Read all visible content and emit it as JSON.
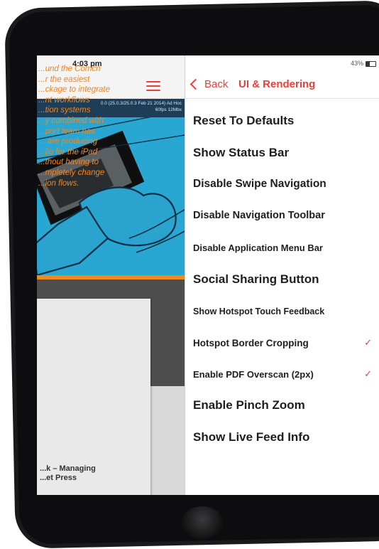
{
  "status": {
    "time": "4:03 pm",
    "battery": "43%"
  },
  "header": {
    "back_label": "Back",
    "title": "UI & Rendering"
  },
  "magazine": {
    "info_line1": "0.0 (25.0.3/25.0.3 Feb 21 2014) Ad Hoc",
    "info_line2": "60fps 12Mbx",
    "quote": "...und the Comcn\n...r the easiest\n...ckage to integrate\n...nt workflows\n...tion systems\n...y combined with\n...port team has\n... are producing\n...lio for the iPad\n...thout having to\n...mpletely change\n...ion flows.",
    "attribution": "...k – Managing\n...et Press"
  },
  "menu": {
    "items": [
      {
        "label": "Reset To Defaults",
        "checked": false
      },
      {
        "label": "Show Status Bar",
        "checked": false
      },
      {
        "label": "Disable Swipe Navigation",
        "checked": false
      },
      {
        "label": "Disable Navigation Toolbar",
        "checked": false
      },
      {
        "label": "Disable Application Menu Bar",
        "checked": false
      },
      {
        "label": "Social Sharing Button",
        "checked": false
      },
      {
        "label": "Show Hotspot Touch Feedback",
        "checked": false
      },
      {
        "label": "Hotspot Border Cropping",
        "checked": true
      },
      {
        "label": "Enable PDF Overscan (2px)",
        "checked": true
      },
      {
        "label": "Enable Pinch Zoom",
        "checked": false
      },
      {
        "label": "Show Live Feed Info",
        "checked": false
      }
    ]
  },
  "icons": {
    "back": "chevron-left-icon",
    "menu": "hamburger-menu-icon",
    "battery": "battery-icon",
    "check": "checkmark-icon"
  },
  "colors": {
    "accent": "#e8413c",
    "quote": "#f5841f",
    "art_bg": "#28a7d2"
  }
}
